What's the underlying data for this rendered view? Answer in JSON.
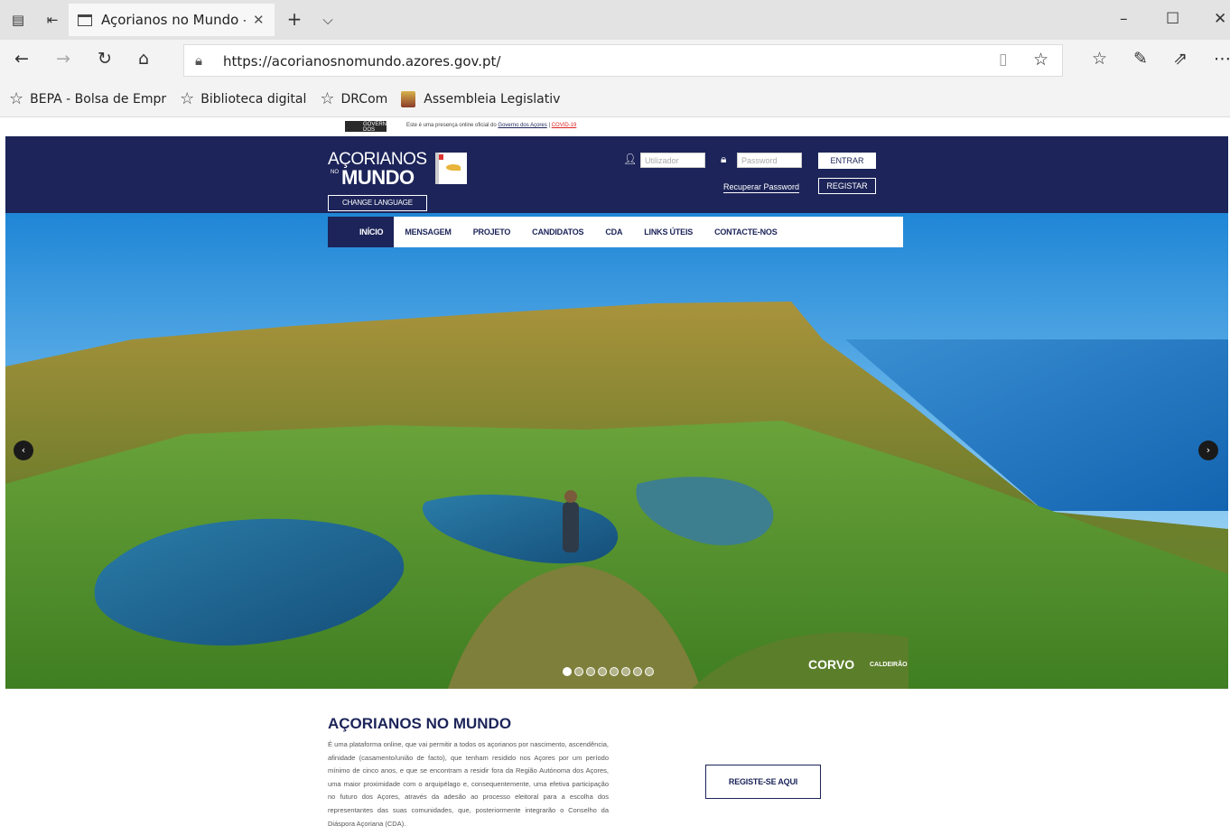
{
  "browser": {
    "tab_title": "Açorianos no Mundo - I",
    "url": "https://acorianosnomundo.azores.gov.pt/",
    "bookmarks": [
      {
        "label": "BEPA - Bolsa de Empr",
        "icon": "star-icon"
      },
      {
        "label": "Biblioteca digital",
        "icon": "star-icon"
      },
      {
        "label": "DRCom",
        "icon": "star-icon"
      },
      {
        "label": "Assembleia Legislativ",
        "icon": "emblem-icon"
      }
    ]
  },
  "gov_strip": {
    "logo_text": "GOVERNO DOS AÇORES",
    "notice": "Este é uma presença online oficial do",
    "link": "Governo dos Açores",
    "covid": "COVID-19"
  },
  "header": {
    "logo_top": "AÇORIANOS",
    "logo_small": "NO",
    "logo_bottom": "MUNDO",
    "change_language": "CHANGE LANGUAGE",
    "username_placeholder": "Utilizador",
    "password_placeholder": "Password",
    "login_label": "ENTRAR",
    "register_label": "REGISTAR",
    "recover_label": "Recuperar Password"
  },
  "menu": {
    "items": [
      "INÍCIO",
      "MENSAGEM",
      "PROJETO",
      "CANDIDATOS",
      "CDA",
      "LINKS ÚTEIS",
      "CONTACTE-NOS"
    ],
    "active_index": 0
  },
  "hero": {
    "caption": "CORVO",
    "caption_sub": "CALDEIRÃO",
    "slide_count": 8,
    "active_slide": 0
  },
  "intro": {
    "title": "AÇORIANOS NO MUNDO",
    "text": "É uma plataforma online, que vai permitir a todos os açorianos por nascimento, ascendência, afinidade (casamento/união de facto), que tenham residido nos Açores por um período mínimo de cinco anos, e que se encontram a residir fora da Região Autónoma dos Açores, uma maior proximidade com o arquipélago e, consequentemente, uma efetiva participação no futuro dos Açores, através da adesão ao processo eleitoral para a escolha dos representantes das suas comunidades, que, posteriormente integrarão o Conselho da Diáspora Açoriana (CDA).",
    "cta": "REGISTE-SE AQUI"
  },
  "colors": {
    "brand_navy": "#1c2459",
    "browser_chrome": "#f3f3f3",
    "covid_red": "#dd2222"
  }
}
